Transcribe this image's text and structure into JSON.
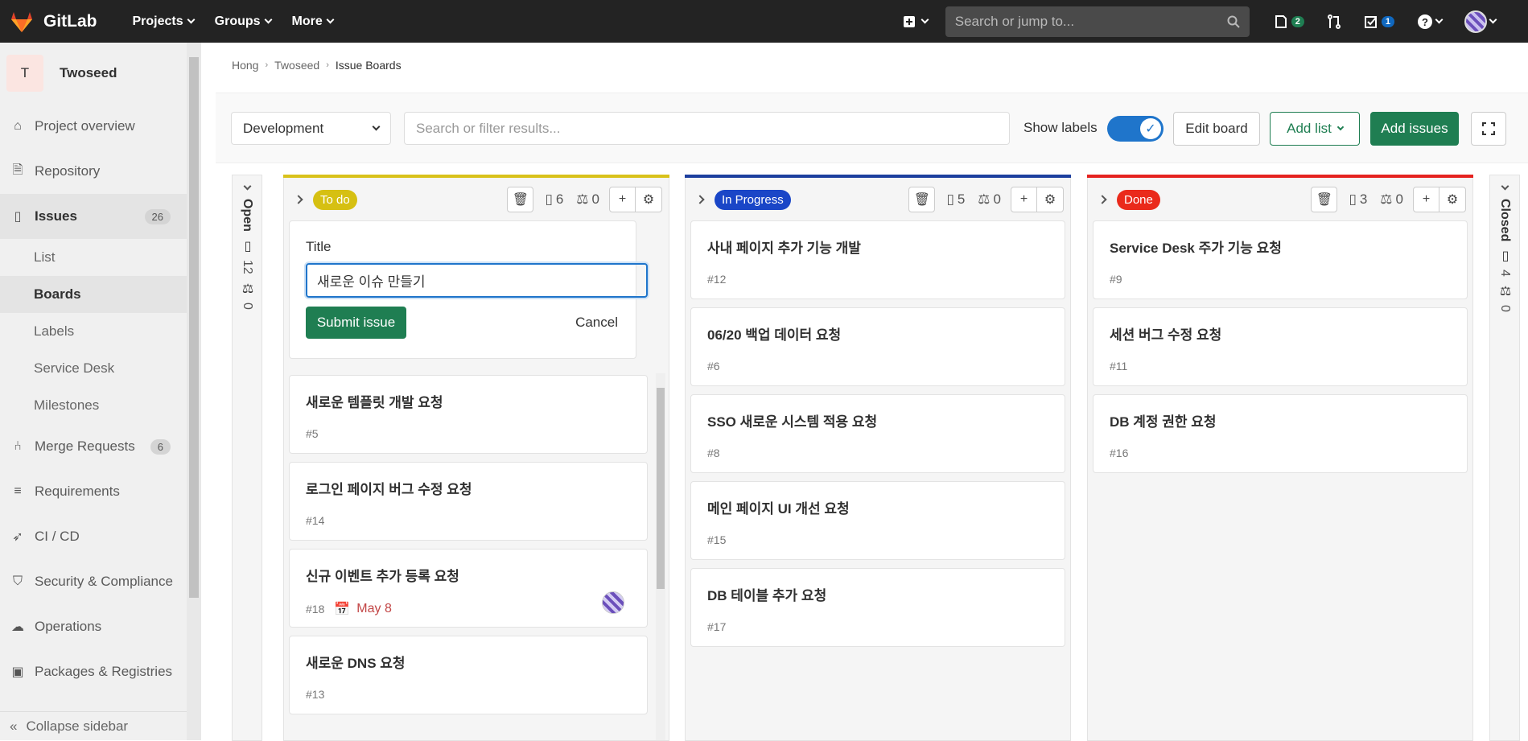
{
  "topbar": {
    "brand": "GitLab",
    "menu": [
      "Projects",
      "Groups",
      "More"
    ],
    "search_placeholder": "Search or jump to...",
    "issues_count": "2",
    "todos_count": "1"
  },
  "sidebar": {
    "project_initial": "T",
    "project_name": "Twoseed",
    "items": [
      {
        "label": "Project overview",
        "icon": "home-icon"
      },
      {
        "label": "Repository",
        "icon": "doc-icon"
      },
      {
        "label": "Issues",
        "icon": "issues-icon",
        "count": "26"
      },
      {
        "label": "Merge Requests",
        "icon": "merge-icon",
        "count": "6"
      },
      {
        "label": "Requirements",
        "icon": "requirements-icon"
      },
      {
        "label": "CI / CD",
        "icon": "rocket-icon"
      },
      {
        "label": "Security & Compliance",
        "icon": "shield-icon"
      },
      {
        "label": "Operations",
        "icon": "cloud-icon"
      },
      {
        "label": "Packages & Registries",
        "icon": "package-icon"
      }
    ],
    "issue_subitems": [
      "List",
      "Boards",
      "Labels",
      "Service Desk",
      "Milestones"
    ],
    "collapse_label": "Collapse sidebar"
  },
  "breadcrumb": [
    "Hong",
    "Twoseed",
    "Issue Boards"
  ],
  "filterbar": {
    "board_name": "Development",
    "search_placeholder": "Search or filter results...",
    "show_labels": "Show labels",
    "edit_board": "Edit board",
    "add_list": "Add list",
    "add_issues": "Add issues"
  },
  "open_list": {
    "label": "Open",
    "count": "12",
    "weight": "0"
  },
  "closed_list": {
    "label": "Closed",
    "count": "4",
    "weight": "0"
  },
  "lists": [
    {
      "label": "To do",
      "color": "#d9c21b",
      "label_bg": "#d6c012",
      "label_fg": "#ffffff",
      "issue_count": "6",
      "weight": "0",
      "form": {
        "title_label": "Title",
        "title_value": "새로운 이슈 만들기",
        "submit": "Submit issue",
        "cancel": "Cancel"
      },
      "cards": [
        {
          "title": "새로운 템플릿 개발 요청",
          "ref": "#5"
        },
        {
          "title": "로그인 페이지 버그 수정 요청",
          "ref": "#14"
        },
        {
          "title": "신규 이벤트 추가 등록 요청",
          "ref": "#18",
          "due": "May 8"
        },
        {
          "title": "새로운 DNS 요청",
          "ref": "#13"
        }
      ]
    },
    {
      "label": "In Progress",
      "color": "#1d3f9e",
      "label_bg": "#1a46c7",
      "label_fg": "#ffffff",
      "issue_count": "5",
      "weight": "0",
      "cards": [
        {
          "title": "사내 페이지 추가 기능 개발",
          "ref": "#12"
        },
        {
          "title": "06/20 백업 데이터 요청",
          "ref": "#6"
        },
        {
          "title": "SSO 새로운 시스템 적용 요청",
          "ref": "#8"
        },
        {
          "title": "메인 페이지 UI 개선 요청",
          "ref": "#15"
        },
        {
          "title": "DB 테이블 추가 요청",
          "ref": "#17"
        }
      ]
    },
    {
      "label": "Done",
      "color": "#e5221f",
      "label_bg": "#ea2a1b",
      "label_fg": "#ffffff",
      "issue_count": "3",
      "weight": "0",
      "cards": [
        {
          "title": "Service Desk 주가 기능 요청",
          "ref": "#9"
        },
        {
          "title": "세션 버그 수정 요청",
          "ref": "#11"
        },
        {
          "title": "DB 계정 권한 요청",
          "ref": "#16"
        }
      ]
    }
  ]
}
